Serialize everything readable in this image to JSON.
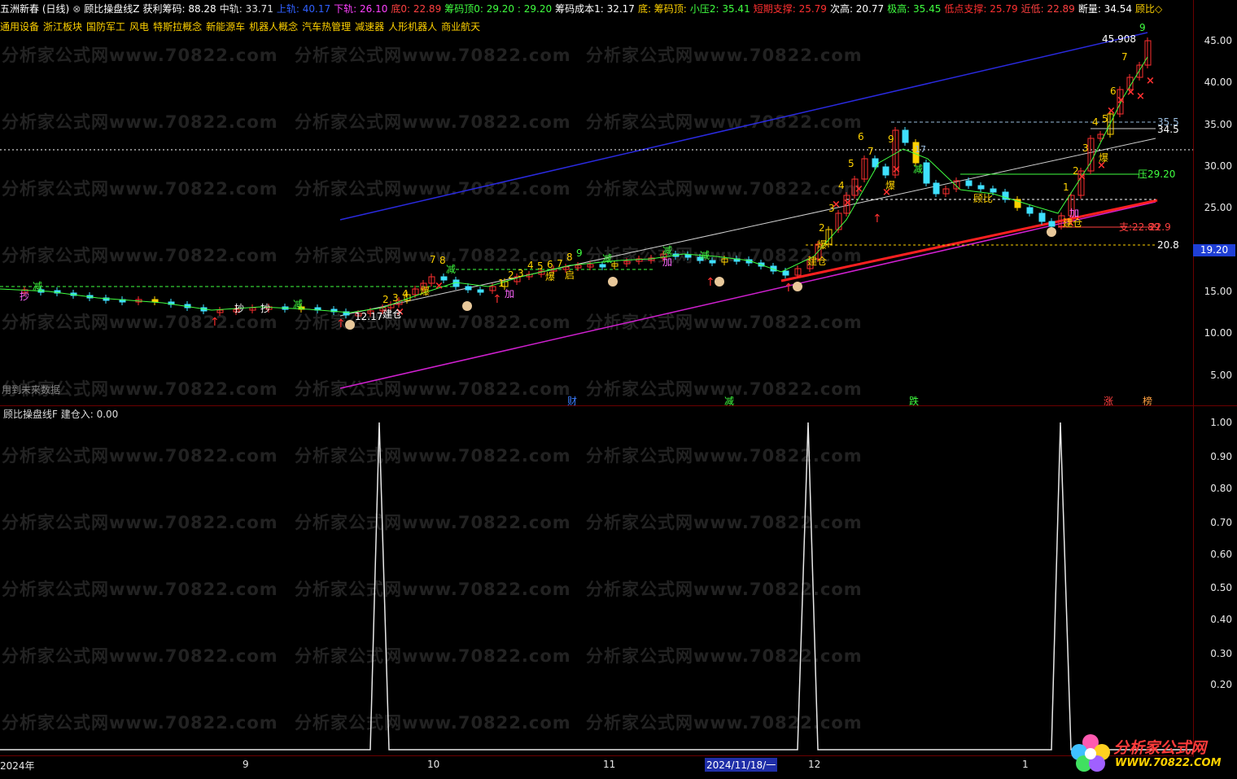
{
  "info_bar": [
    {
      "text": "五洲新春 (日线)",
      "color": "#ffffff"
    },
    {
      "text": "⊗",
      "color": "#bbbbbb"
    },
    {
      "text": "顾比操盘线Z",
      "color": "#ffffff"
    },
    {
      "text": "获利筹码: 88.28",
      "color": "#ffffff"
    },
    {
      "text": "中轨: 33.71",
      "color": "#e0e0e0"
    },
    {
      "text": "上轨: 40.17",
      "color": "#3060ff"
    },
    {
      "text": "下轨: 26.10",
      "color": "#ff40ff"
    },
    {
      "text": "底0: 22.89",
      "color": "#ff4040"
    },
    {
      "text": "筹码顶0: 29.20 : 29.20",
      "color": "#40ff40"
    },
    {
      "text": "筹码成本1: 32.17",
      "color": "#ffffff"
    },
    {
      "text": "底: 筹码顶:",
      "color": "#ffd200"
    },
    {
      "text": "小压2: 35.41",
      "color": "#40ff40"
    },
    {
      "text": "短期支撑: 25.79",
      "color": "#ff3030"
    },
    {
      "text": "次高: 20.77",
      "color": "#ffffff"
    },
    {
      "text": "极高: 35.45",
      "color": "#40ff40"
    },
    {
      "text": "低点支撑: 25.79",
      "color": "#ff3030"
    },
    {
      "text": "近低: 22.89",
      "color": "#ff4040"
    },
    {
      "text": "断量: 34.54",
      "color": "#ffffff"
    },
    {
      "text": "顾比◇",
      "color": "#ffd200"
    }
  ],
  "concepts": [
    "通用设备",
    "浙江板块",
    "国防军工",
    "风电",
    "特斯拉概念",
    "新能源车",
    "机器人概念",
    "汽车热管理",
    "减速器",
    "人形机器人",
    "商业航天"
  ],
  "main_chart": {
    "y_labels": [
      "45.00",
      "40.00",
      "35.00",
      "30.00",
      "25.00",
      "20.00",
      "15.00",
      "10.00",
      "5.00"
    ],
    "current_price": "19.20",
    "future_note": "用到未来数据",
    "annotations": {
      "high": "45.908",
      "low": "12.17",
      "h1": "35.5",
      "h2": "34.5",
      "press": "压29.20",
      "support": "支:22.89",
      "support2": "22.9",
      "level": "20.8",
      "mid": "17"
    }
  },
  "sub_chart": {
    "title": "顾比操盘线F  建仓入: 0.00",
    "y_labels": [
      "1.00",
      "0.90",
      "0.80",
      "0.70",
      "0.60",
      "0.50",
      "0.40",
      "0.30",
      "0.20"
    ]
  },
  "events": [
    {
      "label": "财",
      "color": "#3a7cff"
    },
    {
      "label": "减",
      "color": "#40ff40"
    },
    {
      "label": "跌",
      "color": "#40ff40"
    },
    {
      "label": "涨",
      "color": "#ff4040"
    },
    {
      "label": "榜",
      "color": "#ffa040"
    }
  ],
  "x_axis": [
    "2024年",
    "9",
    "10",
    "11",
    "12",
    "1"
  ],
  "date_cursor": "2024/11/18/一",
  "watermark": "分析家公式网www.70822.com",
  "brand": {
    "name": "分析家公式网",
    "url": "WWW.70822.COM"
  }
}
